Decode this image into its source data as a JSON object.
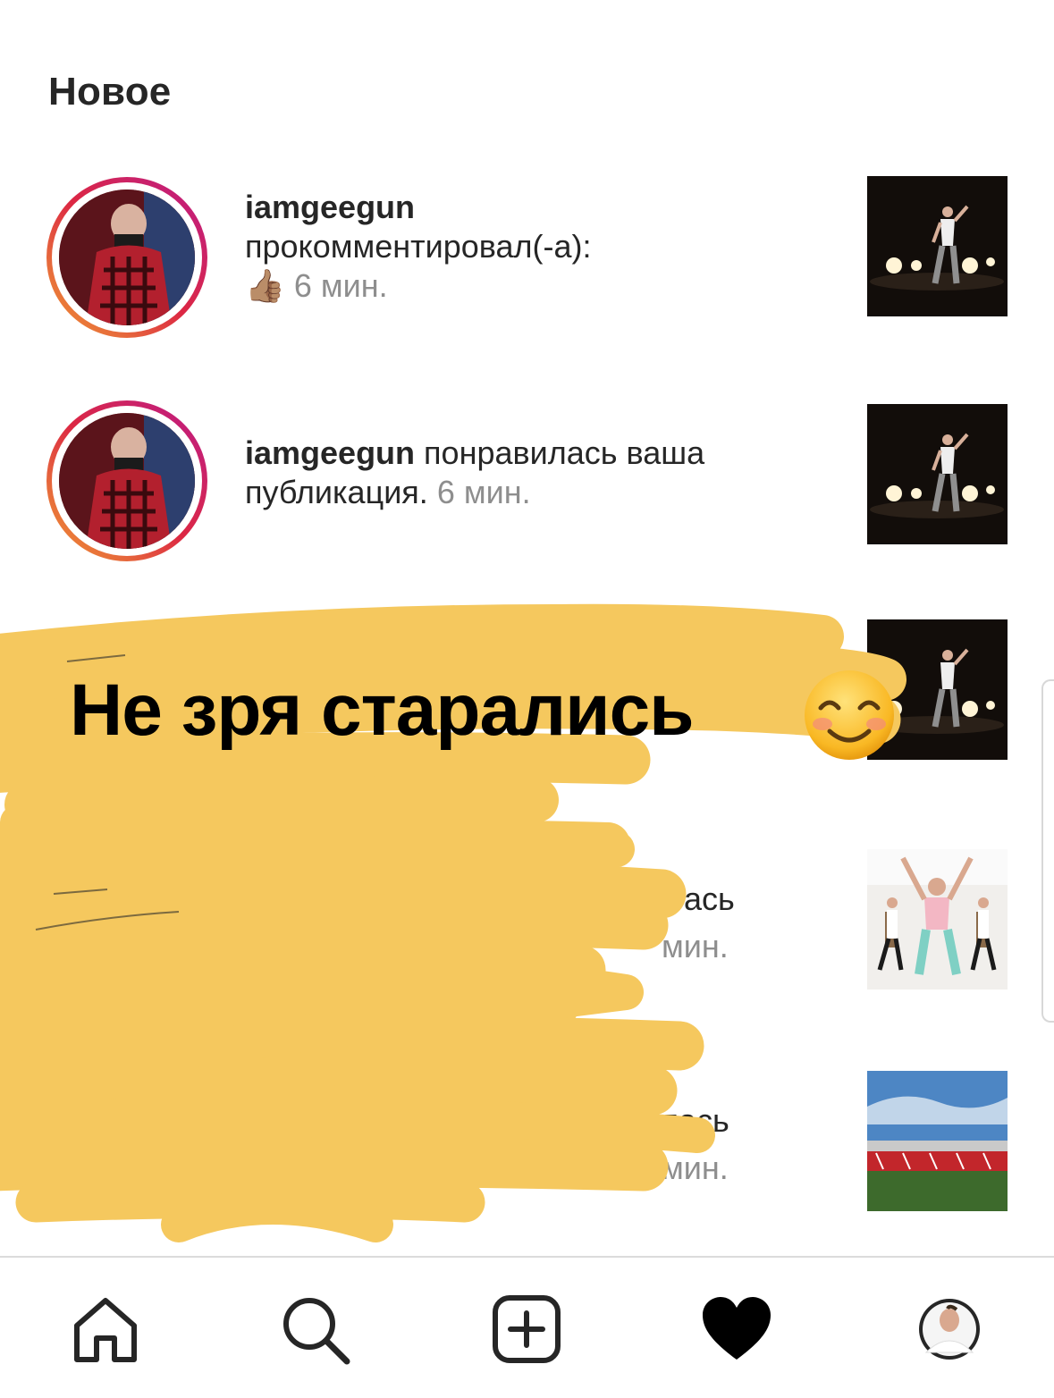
{
  "header": {
    "title": "Новое"
  },
  "notifications": [
    {
      "username": "iamgeegun",
      "action": "прокомментировал(-а):",
      "comment": "👍🏽",
      "time": "6 мин."
    },
    {
      "username": "iamgeegun",
      "action": " понравилась ваша публикация.",
      "time": "6 мин."
    }
  ],
  "obscured": {
    "fragment_1": "ась",
    "fragment_1_time": "мин.",
    "fragment_2": "лась",
    "fragment_2_time": "мин."
  },
  "overlay": {
    "caption": "Не зря старались",
    "emoji": "smiling-face-icon"
  },
  "tabbar": {
    "items": [
      "home-icon",
      "search-icon",
      "new-post-icon",
      "activity-heart-icon",
      "profile-avatar"
    ]
  },
  "colors": {
    "scribble": "#f5c85e",
    "ring_start": "#f09433",
    "ring_end": "#bc1888",
    "time_gray": "#8e8e8e"
  }
}
